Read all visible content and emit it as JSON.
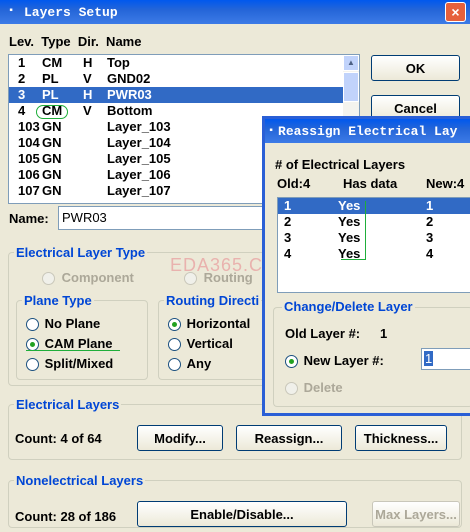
{
  "window": {
    "title": "Layers Setup",
    "close_glyph": "×",
    "icon_glyph": "▪"
  },
  "layer_list": {
    "header": "Lev.  Type  Dir.  Name",
    "rows": [
      {
        "lev": "1",
        "type": "CM",
        "dir": "H",
        "name": "Top"
      },
      {
        "lev": "2",
        "type": "PL",
        "dir": "V",
        "name": "GND02"
      },
      {
        "lev": "3",
        "type": "PL",
        "dir": "H",
        "name": "PWR03"
      },
      {
        "lev": "4",
        "type": "CM",
        "dir": "V",
        "name": "Bottom"
      },
      {
        "lev": "103",
        "type": "GN",
        "dir": "",
        "name": "Layer_103"
      },
      {
        "lev": "104",
        "type": "GN",
        "dir": "",
        "name": "Layer_104"
      },
      {
        "lev": "105",
        "type": "GN",
        "dir": "",
        "name": "Layer_105"
      },
      {
        "lev": "106",
        "type": "GN",
        "dir": "",
        "name": "Layer_106"
      },
      {
        "lev": "107",
        "type": "GN",
        "dir": "",
        "name": "Layer_107"
      }
    ],
    "selected_index": 2
  },
  "buttons": {
    "ok": "OK",
    "cancel": "Cancel"
  },
  "name_field": {
    "label": "Name:",
    "value": "PWR03"
  },
  "electrical_layer_type": {
    "title": "Electrical  Layer Type",
    "component": "Component",
    "routing": "Routing"
  },
  "plane_type": {
    "title": "Plane Type",
    "no_plane": "No Plane",
    "cam_plane": "CAM Plane",
    "split_mixed": "Split/Mixed",
    "selected": "cam_plane"
  },
  "routing_direction": {
    "title": "Routing Directi",
    "horizontal": "Horizontal",
    "vertical": "Vertical",
    "any": "Any",
    "selected": "horizontal"
  },
  "electrical_layers": {
    "title": "Electrical Layers",
    "count": "Count:  4 of 64",
    "modify": "Modify...",
    "reassign": "Reassign...",
    "thickness": "Thickness..."
  },
  "nonelectrical_layers": {
    "title": "Nonelectrical Layers",
    "count": "Count: 28 of 186",
    "enable_disable": "Enable/Disable...",
    "max_layers": "Max Layers..."
  },
  "watermark": "EDA365.COM",
  "reassign_dialog": {
    "title": "Reassign Electrical Lay",
    "num_label": "# of Electrical Layers",
    "old": "Old:4",
    "has_data": "Has data",
    "new": "New:4",
    "rows": [
      {
        "old": "1",
        "data": "Yes",
        "new": "1"
      },
      {
        "old": "2",
        "data": "Yes",
        "new": "2"
      },
      {
        "old": "3",
        "data": "Yes",
        "new": "3"
      },
      {
        "old": "4",
        "data": "Yes",
        "new": "4"
      }
    ],
    "change_title": "Change/Delete Layer",
    "old_layer_label": "Old Layer #:",
    "old_layer_value": "1",
    "new_layer_label": "New Layer #:",
    "new_layer_value": "1",
    "delete_label": "Delete"
  },
  "colors": {
    "accent": "#316ac5",
    "group_title": "#0046d5",
    "annotation": "#1fae3a"
  }
}
